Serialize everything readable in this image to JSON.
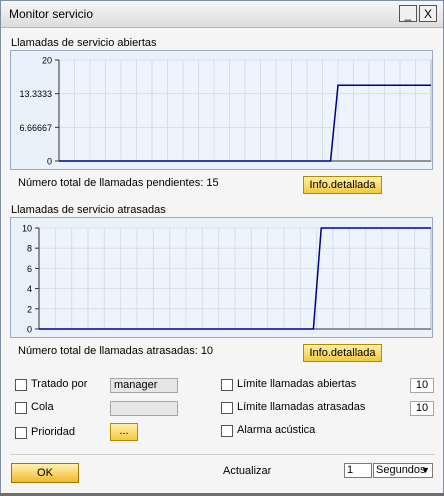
{
  "window": {
    "title": "Monitor servicio",
    "minimize_label": "_",
    "close_label": "X"
  },
  "charts": [
    {
      "title": "Llamadas de servicio abiertas",
      "total_label": "Número total de llamadas pendientes: 15",
      "button_label": "Info.detallada",
      "color": "#00008b"
    },
    {
      "title": "Llamadas de servicio atrasadas",
      "total_label": "Número total de llamadas atrasadas: 10",
      "button_label": "Info.detallada",
      "color": "#00008b"
    }
  ],
  "chart_data": [
    {
      "type": "line",
      "title": "Llamadas de servicio abiertas",
      "ylim": [
        0,
        20
      ],
      "y_ticks": [
        "20",
        "13.3333",
        "6.66667",
        "0"
      ],
      "y_tick_values": [
        20,
        13.3333,
        6.66667,
        0
      ],
      "x": [
        0,
        0.73,
        0.75,
        1.0
      ],
      "series": [
        {
          "values": [
            0,
            0,
            15,
            15
          ]
        }
      ],
      "grid": true
    },
    {
      "type": "line",
      "title": "Llamadas de servicio atrasadas",
      "ylim": [
        0,
        10
      ],
      "y_ticks": [
        "10",
        "8",
        "6",
        "4",
        "2",
        "0"
      ],
      "y_tick_values": [
        10,
        8,
        6,
        4,
        2,
        0
      ],
      "x": [
        0,
        0.7,
        0.72,
        1.0
      ],
      "series": [
        {
          "values": [
            0,
            0,
            10,
            10
          ]
        }
      ],
      "grid": true
    }
  ],
  "options": {
    "tratado_por": {
      "label": "Tratado por",
      "value": "manager",
      "checked": false
    },
    "cola": {
      "label": "Cola",
      "value": "",
      "checked": false
    },
    "prioridad": {
      "label": "Prioridad",
      "button_label": "...",
      "checked": false
    },
    "limite_abiertas": {
      "label": "Límite llamadas abiertas",
      "value": "10",
      "checked": false
    },
    "limite_atrasadas": {
      "label": "Límite llamadas atrasadas",
      "value": "10",
      "checked": false
    },
    "alarma": {
      "label": "Alarma acústica",
      "checked": false
    }
  },
  "footer": {
    "ok_label": "OK",
    "actualizar_label": "Actualizar",
    "actualizar_value": "1",
    "unit_selected": "Segundos",
    "unit_arrow": "▼"
  }
}
